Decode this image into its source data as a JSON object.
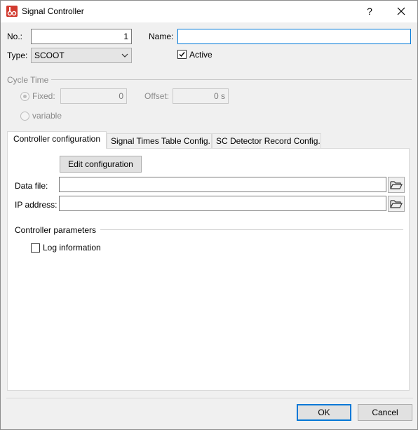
{
  "window": {
    "title": "Signal Controller",
    "help_label": "?",
    "close_label": "✕"
  },
  "general": {
    "no_label": "No.:",
    "no_value": "1",
    "name_label": "Name:",
    "name_value": "",
    "type_label": "Type:",
    "type_value": "SCOOT",
    "active_label": "Active",
    "active_checked": true
  },
  "cycle_time": {
    "section_label": "Cycle Time",
    "fixed_label": "Fixed:",
    "fixed_value": "0",
    "offset_label": "Offset:",
    "offset_value": "0 s",
    "variable_label": "variable",
    "selected": "fixed"
  },
  "tabs": [
    {
      "label": "Controller configuration",
      "active": true
    },
    {
      "label": "Signal Times Table Config.",
      "active": false
    },
    {
      "label": "SC Detector Record Config.",
      "active": false
    }
  ],
  "controller_config": {
    "edit_button": "Edit configuration",
    "data_file_label": "Data file:",
    "data_file_value": "",
    "ip_address_label": "IP address:",
    "ip_address_value": "",
    "parameters_label": "Controller parameters",
    "log_info_label": "Log information",
    "log_info_checked": false
  },
  "footer": {
    "ok_label": "OK",
    "cancel_label": "Cancel"
  },
  "colors": {
    "accent": "#0078d7",
    "app_icon": "#d23a2f"
  }
}
